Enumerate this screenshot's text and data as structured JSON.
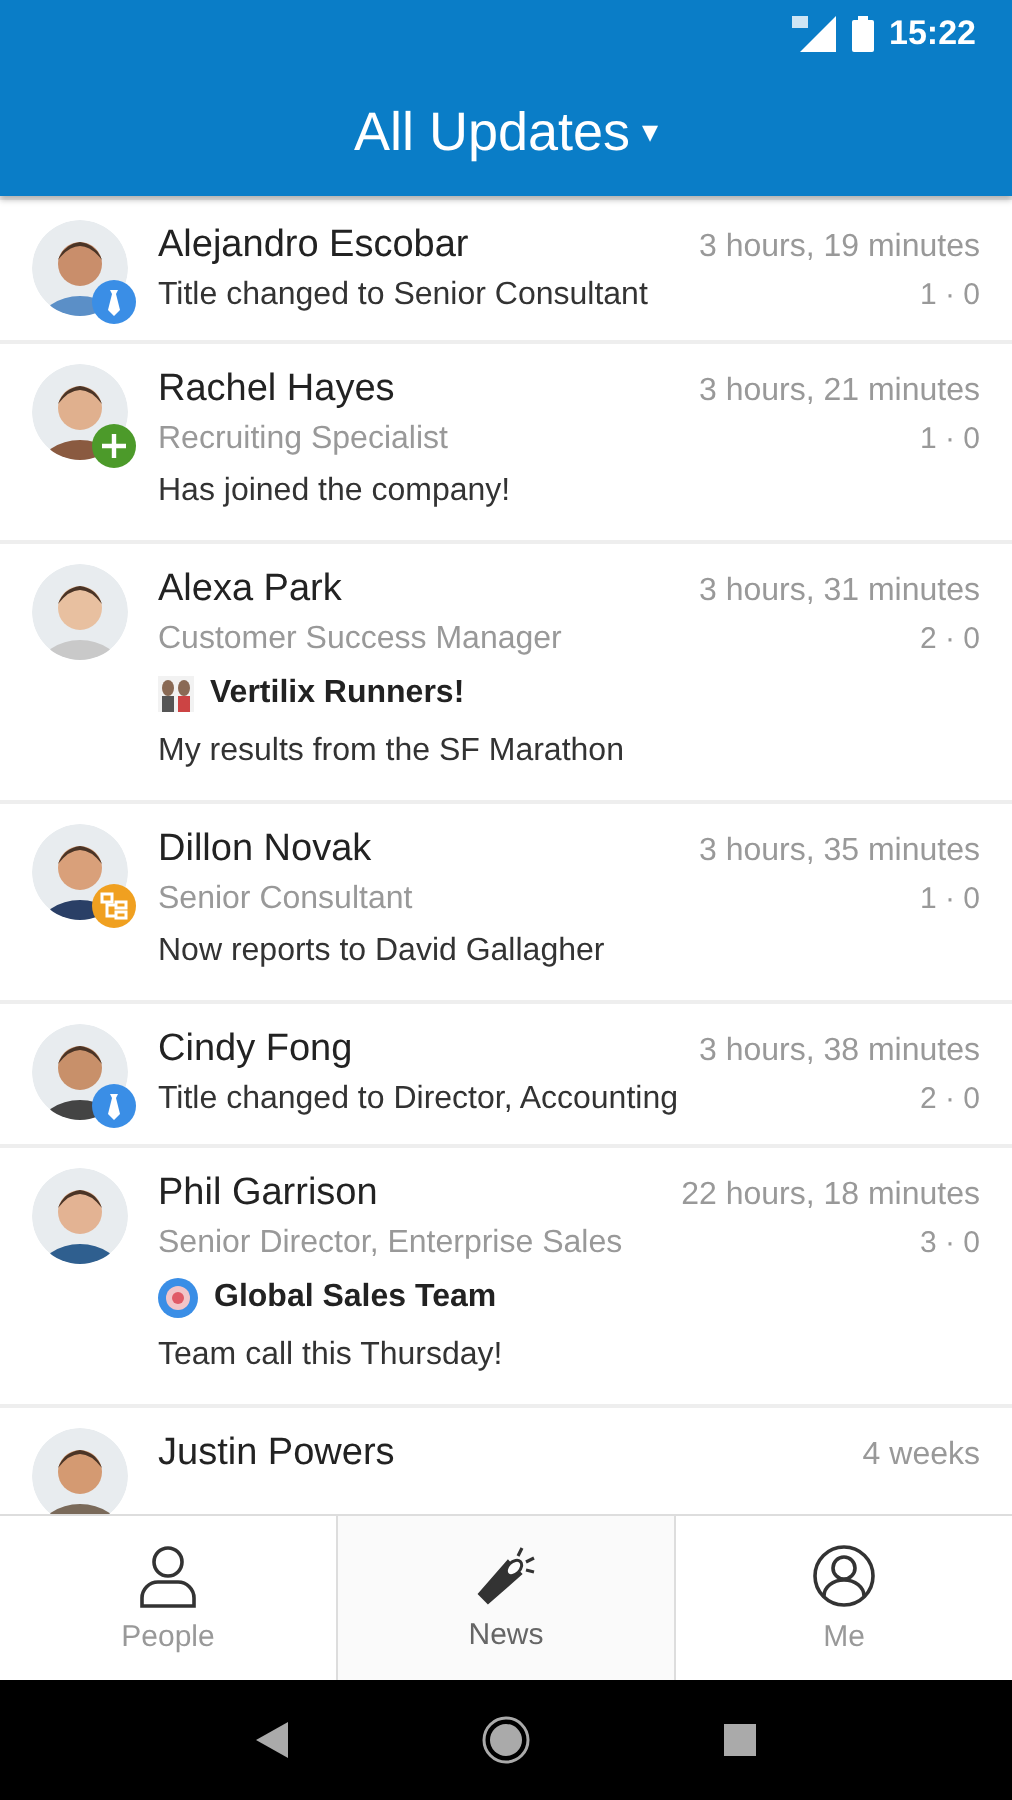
{
  "status_bar": {
    "time": "15:22"
  },
  "header": {
    "title": "All Updates",
    "dropdown": "▾"
  },
  "updates": [
    {
      "name": "Alejandro Escobar",
      "time": "3 hours, 19 minutes",
      "counts": "1 · 0",
      "kind": "title",
      "message": "Title changed to Senior Consultant"
    },
    {
      "name": "Rachel Hayes",
      "time": "3 hours, 21 minutes",
      "counts": "1 · 0",
      "kind": "joined",
      "subtitle": "Recruiting Specialist",
      "message": "Has joined the company!"
    },
    {
      "name": "Alexa Park",
      "time": "3 hours, 31 minutes",
      "counts": "2 · 0",
      "kind": "post",
      "subtitle": "Customer Success Manager",
      "group": {
        "kind": "picture",
        "name": "Vertilix Runners!"
      },
      "message": "My results from the SF Marathon"
    },
    {
      "name": "Dillon Novak",
      "time": "3 hours, 35 minutes",
      "counts": "1 · 0",
      "kind": "reports",
      "subtitle": "Senior Consultant",
      "message": "Now reports to David Gallagher"
    },
    {
      "name": "Cindy Fong",
      "time": "3 hours, 38 minutes",
      "counts": "2 · 0",
      "kind": "title",
      "message": "Title changed to Director, Accounting"
    },
    {
      "name": "Phil Garrison",
      "time": "22 hours, 18 minutes",
      "counts": "3 · 0",
      "kind": "post",
      "subtitle": "Senior Director, Enterprise Sales",
      "group": {
        "kind": "target",
        "name": "Global Sales Team"
      },
      "message": "Team call this Thursday!"
    },
    {
      "name": "Justin Powers",
      "time": "4 weeks",
      "kind": "post"
    }
  ],
  "tabs": [
    {
      "kind": "person",
      "label": "People",
      "selected": false
    },
    {
      "kind": "megaphone",
      "label": "News",
      "selected": true
    },
    {
      "kind": "profile",
      "label": "Me",
      "selected": false
    }
  ]
}
